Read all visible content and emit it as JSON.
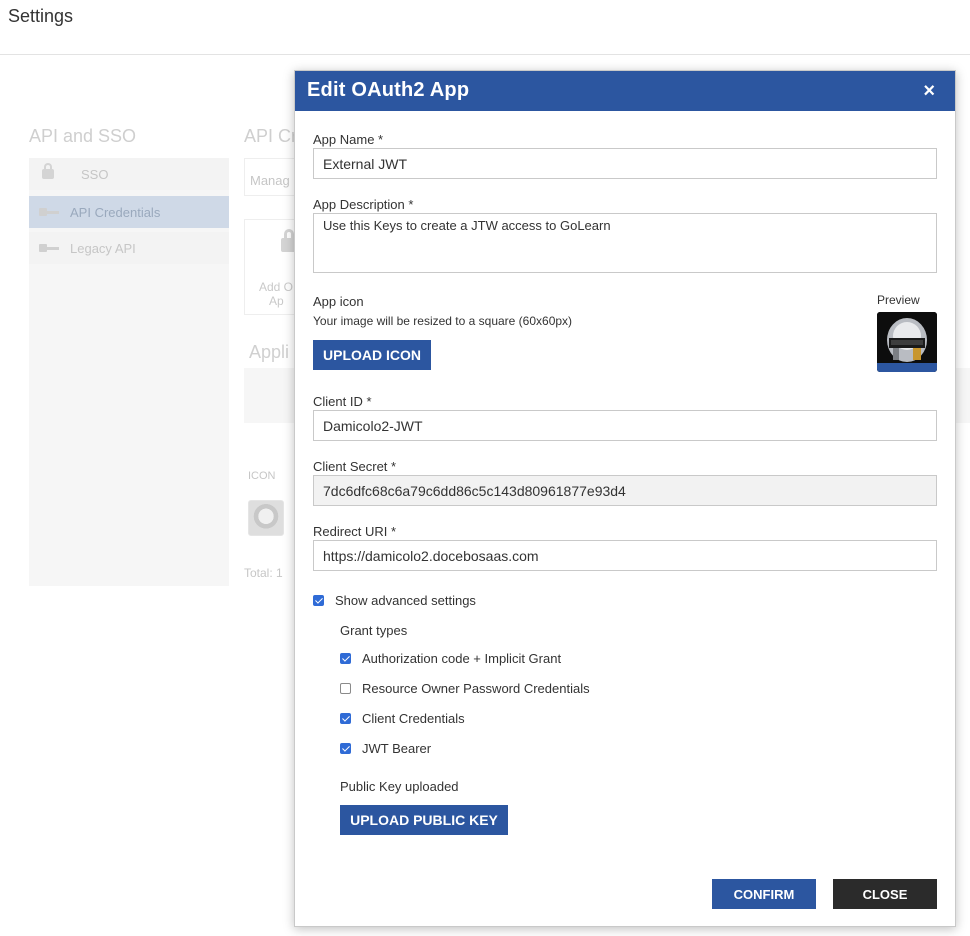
{
  "page": {
    "title": "Settings"
  },
  "background": {
    "section_heading": "API and SSO",
    "sidebar": {
      "items": [
        {
          "label": "SSO",
          "icon": "lock-icon",
          "active": false
        },
        {
          "label": "API Credentials",
          "icon": "key-icon",
          "active": true
        },
        {
          "label": "Legacy API",
          "icon": "key-icon",
          "active": false
        }
      ]
    },
    "right_heading": "API Cr",
    "manage_tab": "Manag",
    "add_card_text": "Add O",
    "add_card_text2": "Ap",
    "apps_heading": "Appli",
    "icon_column": "ICON",
    "total_label": "Total: 1"
  },
  "modal": {
    "title": "Edit OAuth2 App",
    "close_icon": "×",
    "app_name": {
      "label": "App Name *",
      "value": "External JWT"
    },
    "app_description": {
      "label": "App Description *",
      "value": "Use this Keys to create a JTW access to GoLearn"
    },
    "app_icon": {
      "label": "App icon",
      "hint": "Your image will be resized to a square (60x60px)",
      "upload_label": "UPLOAD ICON",
      "preview_label": "Preview"
    },
    "client_id": {
      "label": "Client ID *",
      "value": "Damicolo2-JWT"
    },
    "client_secret": {
      "label": "Client Secret *",
      "value": "7dc6dfc68c6a79c6dd86c5c143d80961877e93d4"
    },
    "redirect_uri": {
      "label": "Redirect URI *",
      "value": "https://damicolo2.docebosaas.com"
    },
    "advanced": {
      "label": "Show advanced settings",
      "checked": true
    },
    "grant_types": {
      "heading": "Grant types",
      "items": [
        {
          "label": "Authorization code + Implicit Grant",
          "checked": true
        },
        {
          "label": "Resource Owner Password Credentials",
          "checked": false
        },
        {
          "label": "Client Credentials",
          "checked": true
        },
        {
          "label": "JWT Bearer",
          "checked": true
        }
      ]
    },
    "public_key": {
      "status": "Public Key uploaded",
      "upload_label": "UPLOAD PUBLIC KEY"
    },
    "confirm_label": "CONFIRM",
    "close_label": "CLOSE",
    "colors": {
      "header": "#2c56a0",
      "primary_button": "#2c56a0",
      "dark_button": "#2b2b2b",
      "checkbox": "#2f6bd6"
    }
  }
}
